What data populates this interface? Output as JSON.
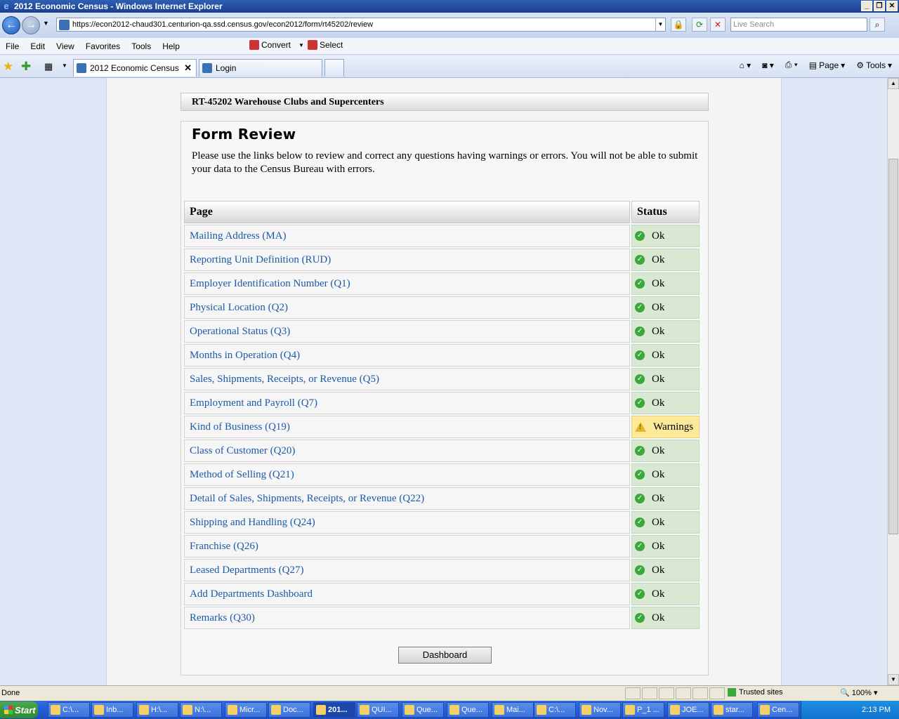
{
  "window": {
    "title": "2012 Economic Census - Windows Internet Explorer"
  },
  "browser": {
    "url": "https://econ2012-chaud301.centurion-qa.ssd.census.gov/econ2012/form/rt45202/review",
    "search_placeholder": "Live Search",
    "menu": [
      "File",
      "Edit",
      "View",
      "Favorites",
      "Tools",
      "Help"
    ],
    "toolbar": {
      "convert": "Convert",
      "select": "Select"
    },
    "tabs": [
      {
        "label": "2012 Economic Census",
        "active": true
      },
      {
        "label": "Login",
        "active": false
      }
    ],
    "command_bar": {
      "page": "Page",
      "tools": "Tools"
    }
  },
  "form": {
    "header": "RT-45202 Warehouse Clubs and Supercenters",
    "title": "Form Review",
    "instructions": "Please use the links below to review and correct any questions having warnings or errors. You will not be able to submit your data to the Census Bureau with errors.",
    "table": {
      "col_page": "Page",
      "col_status": "Status",
      "rows": [
        {
          "page": "Mailing Address (MA)",
          "status": "Ok"
        },
        {
          "page": "Reporting Unit Definition (RUD)",
          "status": "Ok"
        },
        {
          "page": "Employer Identification Number (Q1)",
          "status": "Ok"
        },
        {
          "page": "Physical Location (Q2)",
          "status": "Ok"
        },
        {
          "page": "Operational Status (Q3)",
          "status": "Ok"
        },
        {
          "page": "Months in Operation (Q4)",
          "status": "Ok"
        },
        {
          "page": "Sales, Shipments, Receipts, or Revenue (Q5)",
          "status": "Ok"
        },
        {
          "page": "Employment and Payroll (Q7)",
          "status": "Ok"
        },
        {
          "page": "Kind of Business (Q19)",
          "status": "Warnings"
        },
        {
          "page": "Class of Customer (Q20)",
          "status": "Ok"
        },
        {
          "page": "Method of Selling (Q21)",
          "status": "Ok"
        },
        {
          "page": "Detail of Sales, Shipments, Receipts, or Revenue (Q22)",
          "status": "Ok"
        },
        {
          "page": "Shipping and Handling (Q24)",
          "status": "Ok"
        },
        {
          "page": "Franchise (Q26)",
          "status": "Ok"
        },
        {
          "page": "Leased Departments (Q27)",
          "status": "Ok"
        },
        {
          "page": "Add Departments Dashboard",
          "status": "Ok"
        },
        {
          "page": "Remarks (Q30)",
          "status": "Ok"
        }
      ]
    },
    "dashboard_button": "Dashboard"
  },
  "statusbar": {
    "left": "Done",
    "zone": "Trusted sites",
    "zoom": "100%"
  },
  "taskbar": {
    "start": "Start",
    "items": [
      "C:\\...",
      "Inb...",
      "H:\\...",
      "N:\\...",
      "Micr...",
      "Doc...",
      "201...",
      "QUI...",
      "Que...",
      "Que...",
      "Mai...",
      "C:\\...",
      "Nov...",
      "P_1 ...",
      "JOE...",
      "star...",
      "Cen..."
    ],
    "active_index": 6,
    "clock": "2:13 PM"
  }
}
